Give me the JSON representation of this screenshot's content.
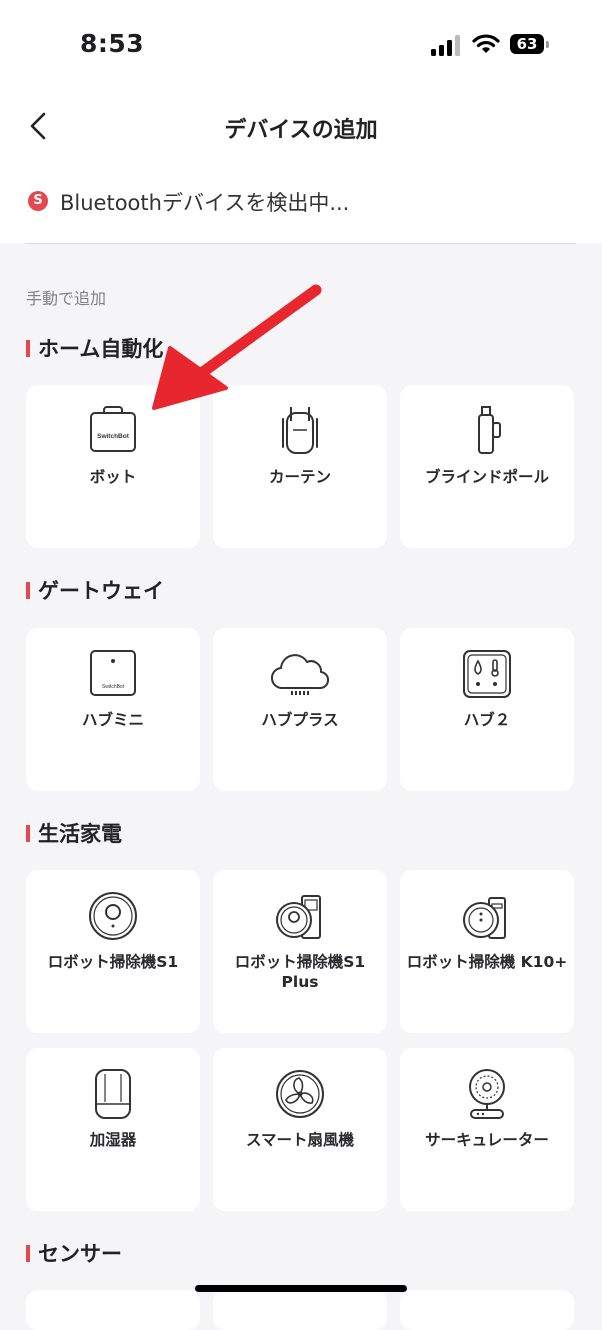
{
  "status_bar": {
    "time": "8:53",
    "battery": "63"
  },
  "nav": {
    "title": "デバイスの追加"
  },
  "scan": {
    "badge": "S",
    "text": "Bluetoothデバイスを検出中..."
  },
  "manual_label": "手動で追加",
  "sections": [
    {
      "title": "ホーム自動化",
      "items": [
        "ボット",
        "カーテン",
        "ブラインドポール"
      ]
    },
    {
      "title": "ゲートウェイ",
      "items": [
        "ハブミニ",
        "ハブプラス",
        "ハブ２"
      ]
    },
    {
      "title": "生活家電",
      "items": [
        "ロボット掃除機S1",
        "ロボット掃除機S1 Plus",
        "ロボット掃除機 K10+",
        "加湿器",
        "スマート扇風機",
        "サーキュレーター"
      ]
    },
    {
      "title": "センサー",
      "items": []
    }
  ],
  "icon_text": {
    "bot": "SwitchBot",
    "hub_mini": "SwitchBot"
  },
  "colors": {
    "accent": "#e5474e",
    "arrow": "#e8262e",
    "background": "#f5f5f7"
  }
}
